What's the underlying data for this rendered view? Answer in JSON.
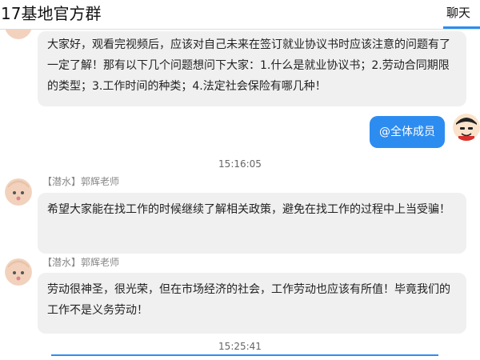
{
  "header": {
    "title": "17基地官方群",
    "tab_chat": "聊天"
  },
  "messages": [
    {
      "text": "大家好，观看完视频后，应该对自己未来在签订就业协议书时应该注意的问题有了一定了解！那有以下几个问题想问下大家：1.什么是就业协议书；2.劳动合同期限的类型；3.工作时间的种类；4.法定社会保险有哪几种！"
    },
    {
      "text": "@全体成员"
    },
    {
      "timestamp": "15:16:05"
    },
    {
      "sender": "【潜水】郭辉老师",
      "text": "希望大家能在找工作的时候继续了解相关政策，避免在找工作的过程中上当受骗！"
    },
    {
      "sender": "【潜水】郭辉老师",
      "text": "劳动很神圣，很光荣，但在市场经济的社会，工作劳动也应该有所值！毕竟我们的工作不是义务劳动！"
    },
    {
      "timestamp": "15:25:41"
    }
  ],
  "colors": {
    "accent": "#2d8cf0",
    "bubble_gray": "#f0f0f0"
  }
}
